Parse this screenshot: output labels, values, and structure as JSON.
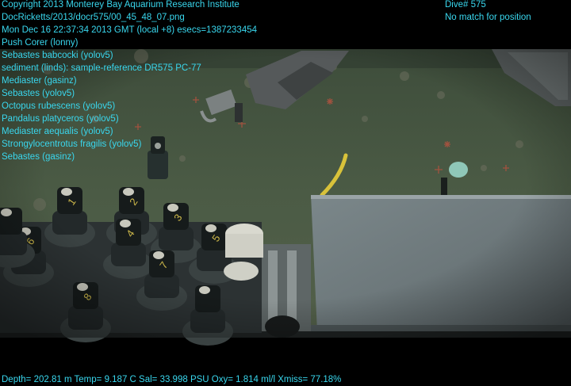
{
  "overlay": {
    "color": "#39d7ee",
    "left_lines": [
      "Copyright 2013 Monterey Bay Aquarium Research Institute",
      "DocRicketts/2013/docr575/00_45_48_07.png",
      "Mon Dec 16 22:37:34 2013 GMT (local +8)  esecs=1387233454",
      "Push Corer (lonny)",
      "Sebastes babcocki (yolov5)",
      "sediment (linds): sample-reference DR575 PC-77",
      "Mediaster (gasinz)",
      "Sebastes (yolov5)",
      "Octopus rubescens (yolov5)",
      "Pandalus platyceros (yolov5)",
      "Mediaster aequalis (yolov5)",
      "Strongylocentrotus fragilis (yolov5)",
      "Sebastes (gasinz)"
    ],
    "right_lines": [
      "Dive# 575",
      "No match for position"
    ],
    "bottom_line": "Depth= 202.81 m  Temp= 9.187 C  Sal= 33.998 PSU  Oxy= 1.814 ml/l  Xmiss= 77.18%"
  },
  "scene": {
    "seafloor_color": "#4a5a45",
    "vehicle_color": "#4b4f4e",
    "tray_color": "#6f7a7d",
    "corer_numbers": [
      "1",
      "2",
      "3",
      "4",
      "5",
      "6",
      "7",
      "8"
    ]
  }
}
